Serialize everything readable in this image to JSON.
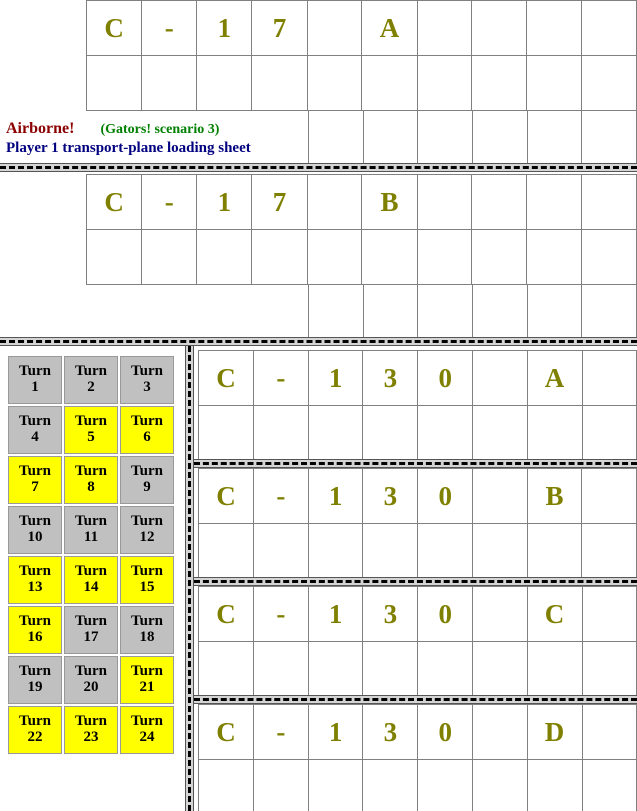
{
  "sheet": {
    "title_main": "Airborne!",
    "title_scenario": "(Gators! scenario 3)",
    "title_sub": "Player 1 transport-plane loading sheet",
    "colors": {
      "title_main": "#8b0000",
      "title_scenario": "#008000",
      "title_sub": "#000080",
      "plane_label": "#808000",
      "turn_active": "#ffff00",
      "turn_inactive": "#c0c0c0",
      "grid_line": "#808080"
    }
  },
  "planes": [
    {
      "id": "c17-a",
      "name": "C-17 A",
      "cells": [
        "C",
        "-",
        "1",
        "7",
        "",
        "A",
        "",
        "",
        "",
        ""
      ],
      "cargo_row": [
        "",
        "",
        "",
        "",
        "",
        "",
        "",
        "",
        "",
        ""
      ]
    },
    {
      "id": "c17-b",
      "name": "C-17 B",
      "cells": [
        "C",
        "-",
        "1",
        "7",
        "",
        "B",
        "",
        "",
        "",
        ""
      ],
      "cargo_row": [
        "",
        "",
        "",
        "",
        "",
        "",
        "",
        "",
        "",
        ""
      ]
    },
    {
      "id": "c130-a",
      "name": "C-130 A",
      "cells": [
        "C",
        "-",
        "1",
        "3",
        "0",
        "",
        "A",
        ""
      ],
      "cargo_row": [
        "",
        "",
        "",
        "",
        "",
        "",
        "",
        ""
      ]
    },
    {
      "id": "c130-b",
      "name": "C-130 B",
      "cells": [
        "C",
        "-",
        "1",
        "3",
        "0",
        "",
        "B",
        ""
      ],
      "cargo_row": [
        "",
        "",
        "",
        "",
        "",
        "",
        "",
        ""
      ]
    },
    {
      "id": "c130-c",
      "name": "C-130 C",
      "cells": [
        "C",
        "-",
        "1",
        "3",
        "0",
        "",
        "C",
        ""
      ],
      "cargo_row": [
        "",
        "",
        "",
        "",
        "",
        "",
        "",
        ""
      ]
    },
    {
      "id": "c130-d",
      "name": "C-130 D",
      "cells": [
        "C",
        "-",
        "1",
        "3",
        "0",
        "",
        "D",
        ""
      ],
      "cargo_row": [
        "",
        "",
        "",
        "",
        "",
        "",
        "",
        ""
      ]
    }
  ],
  "turn_track": {
    "label_prefix": "Turn",
    "rows": [
      [
        {
          "label": "Turn",
          "number": "1",
          "state": "inactive"
        },
        {
          "label": "Turn",
          "number": "2",
          "state": "inactive"
        },
        {
          "label": "Turn",
          "number": "3",
          "state": "inactive"
        }
      ],
      [
        {
          "label": "Turn",
          "number": "4",
          "state": "inactive"
        },
        {
          "label": "Turn",
          "number": "5",
          "state": "active"
        },
        {
          "label": "Turn",
          "number": "6",
          "state": "active"
        }
      ],
      [
        {
          "label": "Turn",
          "number": "7",
          "state": "active"
        },
        {
          "label": "Turn",
          "number": "8",
          "state": "active"
        },
        {
          "label": "Turn",
          "number": "9",
          "state": "inactive"
        }
      ],
      [
        {
          "label": "Turn",
          "number": "10",
          "state": "inactive"
        },
        {
          "label": "Turn",
          "number": "11",
          "state": "inactive"
        },
        {
          "label": "Turn",
          "number": "12",
          "state": "inactive"
        }
      ],
      [
        {
          "label": "Turn",
          "number": "13",
          "state": "active"
        },
        {
          "label": "Turn",
          "number": "14",
          "state": "active"
        },
        {
          "label": "Turn",
          "number": "15",
          "state": "active"
        }
      ],
      [
        {
          "label": "Turn",
          "number": "16",
          "state": "active"
        },
        {
          "label": "Turn",
          "number": "17",
          "state": "inactive"
        },
        {
          "label": "Turn",
          "number": "18",
          "state": "inactive"
        }
      ],
      [
        {
          "label": "Turn",
          "number": "19",
          "state": "inactive"
        },
        {
          "label": "Turn",
          "number": "20",
          "state": "inactive"
        },
        {
          "label": "Turn",
          "number": "21",
          "state": "active"
        }
      ],
      [
        {
          "label": "Turn",
          "number": "22",
          "state": "active"
        },
        {
          "label": "Turn",
          "number": "23",
          "state": "active"
        },
        {
          "label": "Turn",
          "number": "24",
          "state": "active"
        }
      ]
    ]
  }
}
